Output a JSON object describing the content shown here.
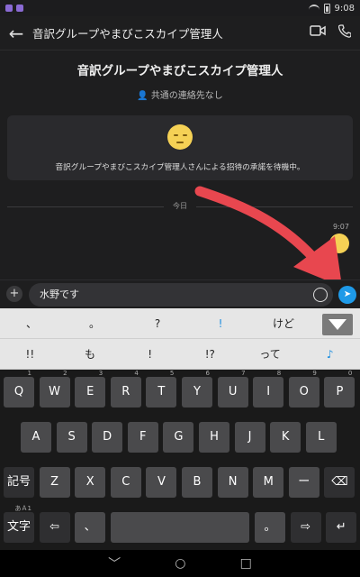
{
  "status_bar": {
    "time": "9:08"
  },
  "header": {
    "back_icon": "arrow-left-icon",
    "title": "音訳グループやまびこスカイプ管理人",
    "video_icon": "video-icon",
    "call_icon": "phone-icon"
  },
  "chat": {
    "title": "音訳グループやまびこスカイプ管理人",
    "contacts_text": "共通の連絡先なし",
    "invite_text": "音訳グループやまびこスカイプ管理人さんによる招待の承諾を待機中。",
    "day_divider": "今日",
    "message_time": "9:07"
  },
  "composer": {
    "value": "水野です",
    "send_icon": "send-icon",
    "emoji_icon": "smiley-icon"
  },
  "candidates": {
    "row1": [
      "、",
      "。",
      "?",
      "!",
      "けど"
    ],
    "row2": [
      "!!",
      "も",
      "!",
      "!?",
      "って",
      "♪"
    ]
  },
  "keyboard": {
    "row1": [
      {
        "k": "Q",
        "s": "1"
      },
      {
        "k": "W",
        "s": "2"
      },
      {
        "k": "E",
        "s": "3"
      },
      {
        "k": "R",
        "s": "4"
      },
      {
        "k": "T",
        "s": "5"
      },
      {
        "k": "Y",
        "s": "6"
      },
      {
        "k": "U",
        "s": "7"
      },
      {
        "k": "I",
        "s": "8"
      },
      {
        "k": "O",
        "s": "9"
      },
      {
        "k": "P",
        "s": "0"
      }
    ],
    "row2": [
      "A",
      "S",
      "D",
      "F",
      "G",
      "H",
      "J",
      "K",
      "L"
    ],
    "row3": [
      "記号",
      "Z",
      "X",
      "C",
      "V",
      "B",
      "N",
      "M",
      "ー",
      "⌫"
    ],
    "row4": [
      "文字",
      "⇦",
      "、",
      "",
      "。",
      "⇨",
      "↵"
    ],
    "lang_sub": "あＡ1"
  },
  "nav": {
    "back": "﹀",
    "home": "○",
    "recents": "□"
  }
}
